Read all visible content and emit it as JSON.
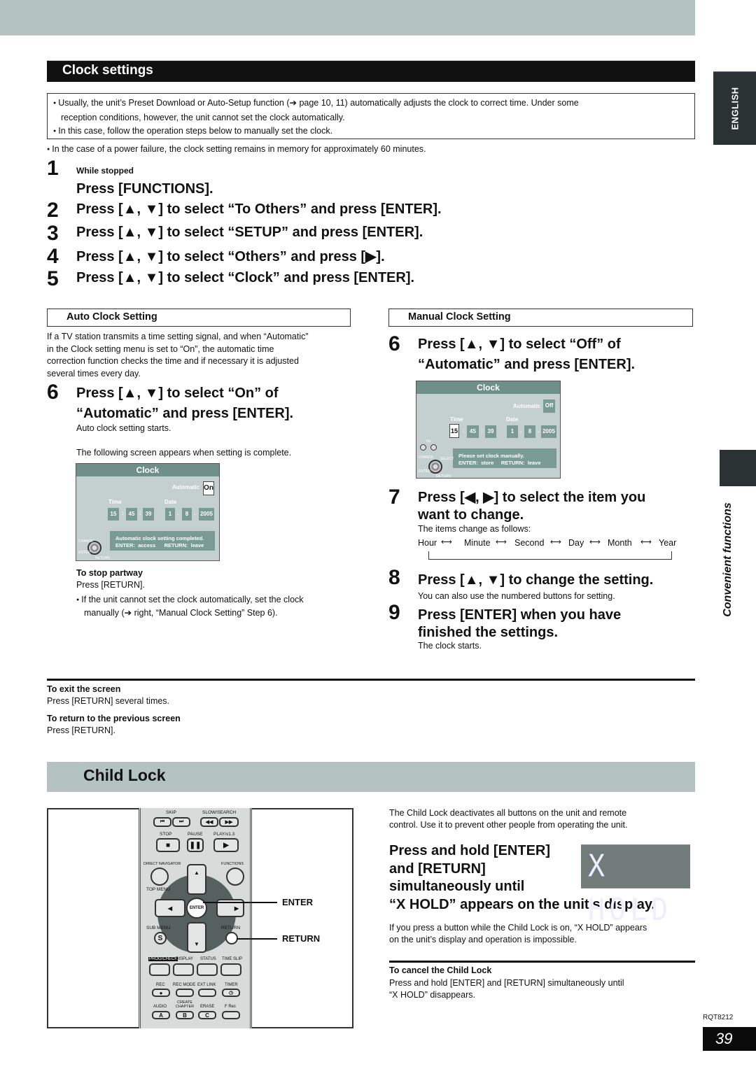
{
  "side_tabs": {
    "language": "ENGLISH",
    "section": "Convenient functions"
  },
  "clock_settings": {
    "title": "Clock settings",
    "notes": [
      "Usually, the unit’s Preset Download or Auto-Setup function (➔ page 10, 11) automatically adjusts the clock to correct time. Under some",
      "reception conditions, however, the unit cannot set the clock automatically.",
      "In this case, follow the operation steps below to manually set the clock."
    ],
    "power_note": "In the case of a power failure, the clock setting remains in memory for approximately 60 minutes.",
    "steps": [
      {
        "num": "1",
        "pre": "While stopped",
        "text": "Press [FUNCTIONS]."
      },
      {
        "num": "2",
        "text": "Press [▲, ▼] to select “To Others” and press [ENTER]."
      },
      {
        "num": "3",
        "text": "Press [▲, ▼] to select “SETUP” and press [ENTER]."
      },
      {
        "num": "4",
        "text": "Press [▲, ▼] to select “Others” and press [▶]."
      },
      {
        "num": "5",
        "text": "Press [▲, ▼] to select “Clock” and press [ENTER]."
      }
    ],
    "auto": {
      "heading": "Auto Clock Setting",
      "intro": [
        "If a TV station transmits a time setting signal, and when “Automatic”",
        "in the Clock setting menu is set to “On”, the automatic time",
        "correction function checks the time and if necessary it is adjusted",
        "several times every day."
      ],
      "step_num": "6",
      "step_lines": [
        "Press [▲, ▼] to select “On” of",
        "“Automatic” and press [ENTER]."
      ],
      "after": "Auto clock setting starts.",
      "screen_note": "The following screen appears when setting is complete.",
      "screen": {
        "title": "Clock",
        "automatic_label": "Automatic",
        "automatic_value": "On",
        "time_label": "Time",
        "date_label": "Date",
        "hour": "15",
        "minute": "45",
        "second": "39",
        "day": "1",
        "month": "8",
        "year": "2005",
        "msg1": "Automatic clock setting completed.",
        "msg2": "ENTER:  access      RETURN:  leave",
        "change": "CHANGE",
        "enter": "ENTER",
        "return": "RETURN"
      },
      "stop_title": "To stop partway",
      "stop_text": "Press [RETURN].",
      "fail_lines": [
        "If the unit cannot set the clock automatically, set the clock",
        "manually (➔ right, “Manual Clock Setting” Step 6)."
      ]
    },
    "manual": {
      "heading": "Manual Clock Setting",
      "step6_num": "6",
      "step6_lines": [
        "Press [▲, ▼] to select “Off” of",
        "“Automatic” and press [ENTER]."
      ],
      "screen": {
        "title": "Clock",
        "automatic_label": "Automatic",
        "automatic_value": "Off",
        "time_label": "Time",
        "date_label": "Date",
        "hour": "15",
        "minute": "45",
        "second": "39",
        "day": "1",
        "month": "8",
        "year": "2005",
        "msg1": "Please set clock manually.",
        "msg2": "ENTER:  store     RETURN:  leave",
        "no": "No.",
        "change": "CHANGE",
        "select": "SELECT",
        "enter": "ENTER",
        "return": "RETURN"
      },
      "step7_num": "7",
      "step7_lines": [
        "Press [◀, ▶] to select the item you",
        "want to change."
      ],
      "step7_sub": "The items change as follows:",
      "sequence": [
        "Hour",
        "Minute",
        "Second",
        "Day",
        "Month",
        "Year"
      ],
      "step8_num": "8",
      "step8": "Press [▲, ▼] to change the setting.",
      "step8_sub": "You can also use the numbered buttons for setting.",
      "step9_num": "9",
      "step9_lines": [
        "Press [ENTER] when you have",
        "finished the settings."
      ],
      "step9_sub": "The clock starts."
    },
    "exit_title": "To exit the screen",
    "exit_text": "Press [RETURN] several times.",
    "prev_title": "To return to the previous screen",
    "prev_text": "Press [RETURN]."
  },
  "child_lock": {
    "title": "Child Lock",
    "intro": [
      "The Child Lock deactivates all buttons on the unit and remote",
      "control. Use it to prevent other people from operating the unit."
    ],
    "instruction_lines": [
      "Press and hold [ENTER]",
      "and [RETURN]",
      "simultaneously until",
      "“X HOLD” appears on the unit’s display."
    ],
    "display_text": "X HOLD",
    "warning": [
      "If you press a button while the Child Lock is on, “X HOLD” appears",
      "on the unit’s display and operation is impossible."
    ],
    "cancel_title": "To cancel the Child Lock",
    "cancel_lines": [
      "Press and hold [ENTER] and [RETURN] simultaneously until",
      "“X HOLD” disappears."
    ],
    "remote": {
      "skip": "SKIP",
      "slow_search": "SLOW/SEARCH",
      "stop": "STOP",
      "pause": "PAUSE",
      "play": "PLAY/x1.3",
      "direct_navigator": "DIRECT NAVIGATOR",
      "functions": "FUNCTIONS",
      "top_menu": "TOP MENU",
      "enter": "ENTER",
      "sub_menu": "SUB MENU",
      "return": "RETURN",
      "s": "S",
      "prog_check": "PROG/CHECK",
      "display": "DISPLAY",
      "status": "STATUS",
      "time_slip": "TIME SLIP",
      "rec": "REC",
      "rec_mode": "REC MODE",
      "ext_link": "EXT LINK",
      "timer": "TIMER",
      "audio": "AUDIO",
      "create_chapter": "CREATE CHAPTER",
      "erase": "ERASE",
      "f_rec": "F Rec",
      "a": "A",
      "b": "B",
      "c": "C"
    },
    "callouts": {
      "enter": "ENTER",
      "return": "RETURN"
    }
  },
  "footer": {
    "model": "RQT8212",
    "page": "39"
  }
}
